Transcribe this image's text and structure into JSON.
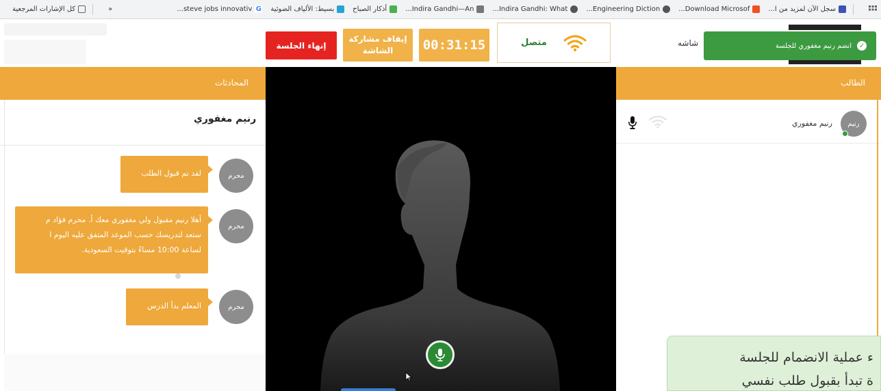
{
  "bookmarks": {
    "apps_icon": "apps-grid-icon",
    "items": [
      {
        "label": "سجل الآن لمزيد من ا...",
        "color": "#3f51b5"
      },
      {
        "label": "Download Microsof...",
        "color": "#f25022"
      },
      {
        "label": "Engineering Diction...",
        "color": "#555555"
      },
      {
        "label": "Indira Gandhi: What...",
        "color": "#555555"
      },
      {
        "label": "Indira Gandhi—An...",
        "color": "#777777"
      },
      {
        "label": "أذكار الصباح",
        "color": "#4caf50"
      },
      {
        "label": "بسيط: الألياف الضوئية",
        "color": "#29a3d4"
      },
      {
        "label": "steve jobs innovativ...",
        "color": "#4285f4"
      }
    ],
    "more": "«",
    "all_bookmarks": "كل الإشارات المرجعية"
  },
  "controls": {
    "end_session": "إنهاء الجلسة",
    "stop_share_line1": "إيقاف مشاركة",
    "stop_share_line2": "الشاشة",
    "timer": "00:31:15",
    "connection_status": "متصل",
    "share_word": "شاشه",
    "toast": "انضم رنيم مغفوري للجلسة"
  },
  "panels": {
    "conversations_title": "المحادثات",
    "student_title": "الطالب"
  },
  "chat": {
    "contact_name": "رنيم مغفوري",
    "messages": [
      {
        "sender": "محرم",
        "text": "لقد تم قبول الطلب"
      },
      {
        "sender": "محرم",
        "lines": [
          "أهلا رنيم مقبول ولي مغفوري معك أ. محرم فؤاد م",
          "ستعد لتدريسك حسب الموعد المتفق عليه اليوم ا",
          "لساعة 10:00 مساءً بتوقيت السعودية."
        ]
      },
      {
        "sender": "محرم",
        "text": "المعلم بدأ الدرس"
      }
    ]
  },
  "student": {
    "avatar_label": "رنيم",
    "name": "رنيم مغفوري"
  },
  "caption": {
    "line1": "ء عملية الانضمام للجلسة",
    "line2": "ة تبدأ بقبول طلب نفسي"
  },
  "colors": {
    "orange": "#eea83b",
    "danger": "#e52421",
    "success": "#3c9a41"
  }
}
